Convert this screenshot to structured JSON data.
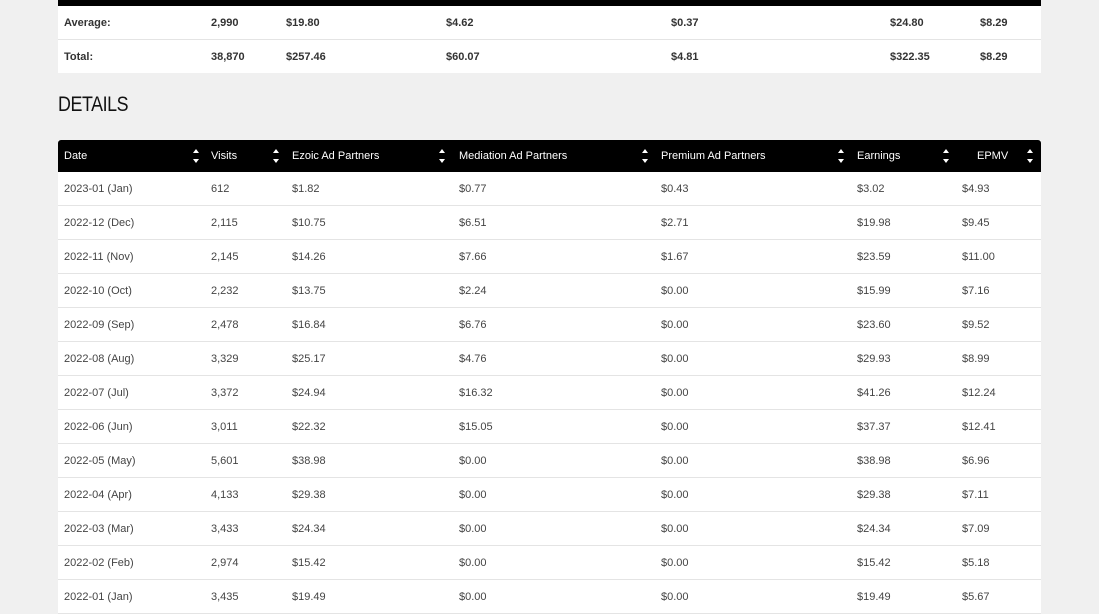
{
  "summary": {
    "average": {
      "label": "Average:",
      "visits": "2,990",
      "ezoic": "$19.80",
      "mediation": "$4.62",
      "premium": "$0.37",
      "earnings": "$24.80",
      "epmv": "$8.29"
    },
    "total": {
      "label": "Total:",
      "visits": "38,870",
      "ezoic": "$257.46",
      "mediation": "$60.07",
      "premium": "$4.81",
      "earnings": "$322.35",
      "epmv": "$8.29"
    }
  },
  "details": {
    "title": "DETAILS",
    "columns": [
      "Date",
      "Visits",
      "Ezoic Ad Partners",
      "Mediation Ad Partners",
      "Premium Ad Partners",
      "Earnings",
      "EPMV"
    ],
    "rows": [
      [
        "2023-01 (Jan)",
        "612",
        "$1.82",
        "$0.77",
        "$0.43",
        "$3.02",
        "$4.93"
      ],
      [
        "2022-12 (Dec)",
        "2,115",
        "$10.75",
        "$6.51",
        "$2.71",
        "$19.98",
        "$9.45"
      ],
      [
        "2022-11 (Nov)",
        "2,145",
        "$14.26",
        "$7.66",
        "$1.67",
        "$23.59",
        "$11.00"
      ],
      [
        "2022-10 (Oct)",
        "2,232",
        "$13.75",
        "$2.24",
        "$0.00",
        "$15.99",
        "$7.16"
      ],
      [
        "2022-09 (Sep)",
        "2,478",
        "$16.84",
        "$6.76",
        "$0.00",
        "$23.60",
        "$9.52"
      ],
      [
        "2022-08 (Aug)",
        "3,329",
        "$25.17",
        "$4.76",
        "$0.00",
        "$29.93",
        "$8.99"
      ],
      [
        "2022-07 (Jul)",
        "3,372",
        "$24.94",
        "$16.32",
        "$0.00",
        "$41.26",
        "$12.24"
      ],
      [
        "2022-06 (Jun)",
        "3,011",
        "$22.32",
        "$15.05",
        "$0.00",
        "$37.37",
        "$12.41"
      ],
      [
        "2022-05 (May)",
        "5,601",
        "$38.98",
        "$0.00",
        "$0.00",
        "$38.98",
        "$6.96"
      ],
      [
        "2022-04 (Apr)",
        "4,133",
        "$29.38",
        "$0.00",
        "$0.00",
        "$29.38",
        "$7.11"
      ],
      [
        "2022-03 (Mar)",
        "3,433",
        "$24.34",
        "$0.00",
        "$0.00",
        "$24.34",
        "$7.09"
      ],
      [
        "2022-02 (Feb)",
        "2,974",
        "$15.42",
        "$0.00",
        "$0.00",
        "$15.42",
        "$5.18"
      ],
      [
        "2022-01 (Jan)",
        "3,435",
        "$19.49",
        "$0.00",
        "$0.00",
        "$19.49",
        "$5.67"
      ]
    ]
  },
  "icons": {
    "sort": "sort-icon"
  }
}
